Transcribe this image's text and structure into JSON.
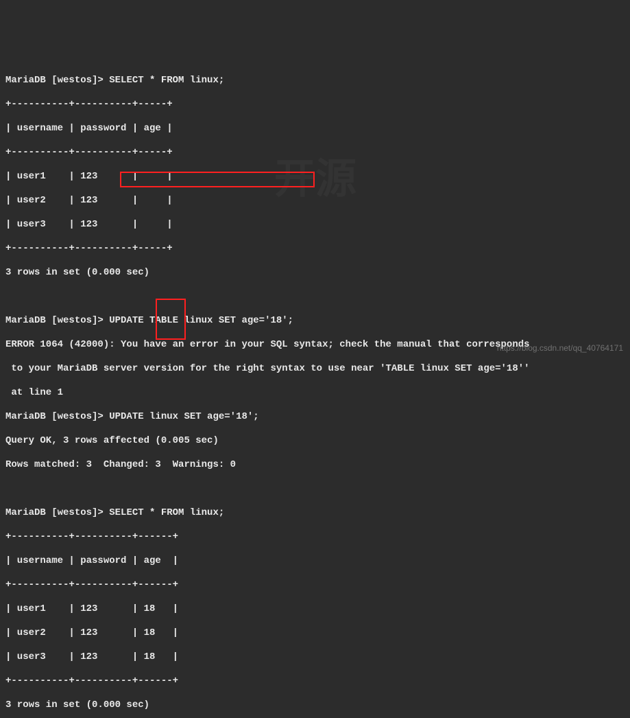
{
  "prompt": "MariaDB [westos]> ",
  "queries": {
    "select1": "SELECT * FROM linux;",
    "update_bad": "UPDATE TABLE linux SET age='18';",
    "update_good": "UPDATE linux SET age='18';",
    "select2": "SELECT * FROM linux;"
  },
  "table_border_top": "+----------+----------+-----+",
  "table_header": "| username | password | age |",
  "table_border_mid": "+----------+----------+-----+",
  "table1_rows": [
    "| user1    | 123      |     |",
    "| user2    | 123      |     |",
    "| user3    | 123      |     |"
  ],
  "table_border_bot": "+----------+----------+-----+",
  "rows_msg1": "3 rows in set (0.000 sec)",
  "error_line1": "ERROR 1064 (42000): You have an error in your SQL syntax; check the manual that corresponds",
  "error_line2": " to your MariaDB server version for the right syntax to use near 'TABLE linux SET age='18''",
  "error_line3": " at line 1",
  "ok_line1": "Query OK, 3 rows affected (0.005 sec)",
  "ok_line2": "Rows matched: 3  Changed: 3  Warnings: 0",
  "table2_border_top": "+----------+----------+------+",
  "table2_header": "| username | password | age  |",
  "table2_border_mid": "+----------+----------+------+",
  "table2_rows": [
    "| user1    | 123      | 18   |",
    "| user2    | 123      | 18   |",
    "| user3    | 123      | 18   |"
  ],
  "table2_border_bot": "+----------+----------+------+",
  "rows_msg2": "3 rows in set (0.000 sec)",
  "watermark_url": "https://blog.csdn.net/qq_40764171",
  "chart_data": {
    "type": "table",
    "before": {
      "columns": [
        "username",
        "password",
        "age"
      ],
      "rows": [
        [
          "user1",
          "123",
          ""
        ],
        [
          "user2",
          "123",
          ""
        ],
        [
          "user3",
          "123",
          ""
        ]
      ]
    },
    "after": {
      "columns": [
        "username",
        "password",
        "age"
      ],
      "rows": [
        [
          "user1",
          "123",
          "18"
        ],
        [
          "user2",
          "123",
          "18"
        ],
        [
          "user3",
          "123",
          "18"
        ]
      ]
    }
  }
}
